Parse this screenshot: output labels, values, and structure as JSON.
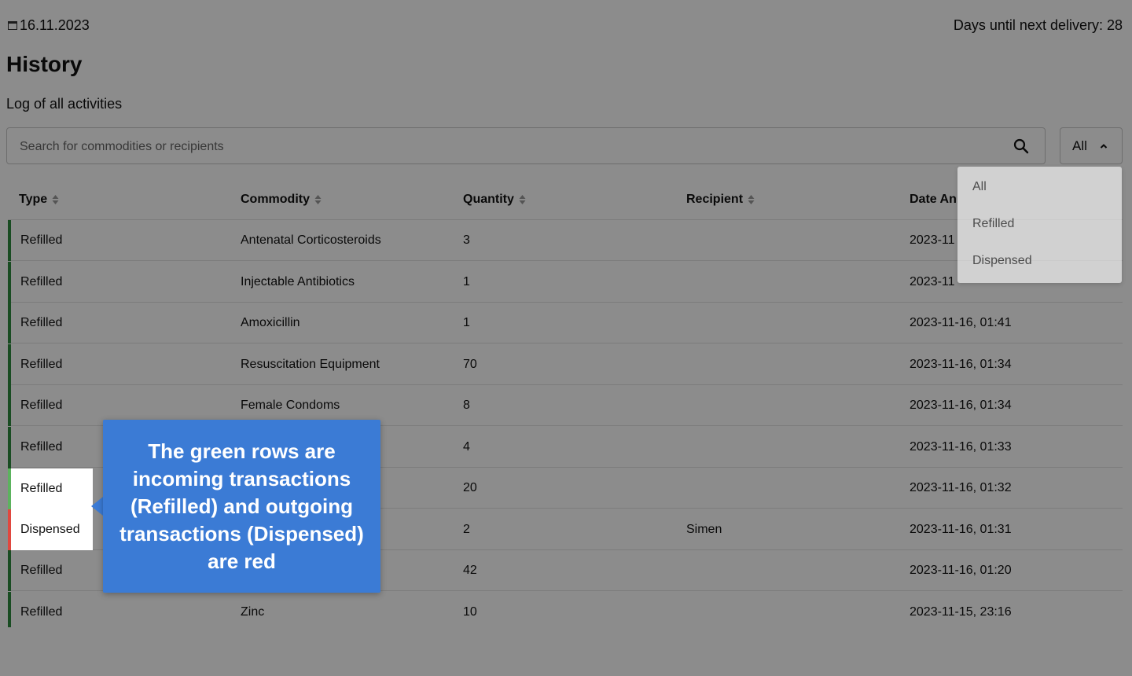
{
  "header": {
    "date": "16.11.2023",
    "delivery_text": "Days until next delivery: 28"
  },
  "page": {
    "title": "History",
    "subtitle": "Log of all activities"
  },
  "search": {
    "placeholder": "Search for commodities or recipients"
  },
  "filter": {
    "selected": "All",
    "options": [
      "All",
      "Refilled",
      "Dispensed"
    ]
  },
  "table": {
    "columns": [
      "Type",
      "Commodity",
      "Quantity",
      "Recipient",
      "Date And Time"
    ],
    "visible_header_5": "Date An",
    "rows": [
      {
        "type": "Refilled",
        "commodity": "Antenatal Corticosteroids",
        "quantity": "3",
        "recipient": "",
        "datetime": "2023-11"
      },
      {
        "type": "Refilled",
        "commodity": "Injectable Antibiotics",
        "quantity": "1",
        "recipient": "",
        "datetime": "2023-11"
      },
      {
        "type": "Refilled",
        "commodity": "Amoxicillin",
        "quantity": "1",
        "recipient": "",
        "datetime": "2023-11-16, 01:41"
      },
      {
        "type": "Refilled",
        "commodity": "Resuscitation Equipment",
        "quantity": "70",
        "recipient": "",
        "datetime": "2023-11-16, 01:34"
      },
      {
        "type": "Refilled",
        "commodity": "Female Condoms",
        "quantity": "8",
        "recipient": "",
        "datetime": "2023-11-16, 01:34"
      },
      {
        "type": "Refilled",
        "commodity": "",
        "quantity": "4",
        "recipient": "",
        "datetime": "2023-11-16, 01:33"
      },
      {
        "type": "Refilled",
        "commodity": "",
        "quantity": "20",
        "recipient": "",
        "datetime": "2023-11-16, 01:32"
      },
      {
        "type": "Dispensed",
        "commodity": "",
        "quantity": "2",
        "recipient": "Simen",
        "datetime": "2023-11-16, 01:31"
      },
      {
        "type": "Refilled",
        "commodity": "",
        "quantity": "42",
        "recipient": "",
        "datetime": "2023-11-16, 01:20"
      },
      {
        "type": "Refilled",
        "commodity": "Zinc",
        "quantity": "10",
        "recipient": "",
        "datetime": "2023-11-15, 23:16"
      }
    ]
  },
  "tooltip": {
    "text": "The green rows are incoming transactions (Refilled) and outgoing transactions (Dispensed) are red"
  },
  "colors": {
    "refilled": "#2e8b3e",
    "dispensed": "#d9423a",
    "callout": "#3b7bd5"
  },
  "icons": {
    "date": "calendar-icon",
    "search": "search-icon",
    "filter": "chevron-up-icon",
    "sort": "sort-icon"
  }
}
